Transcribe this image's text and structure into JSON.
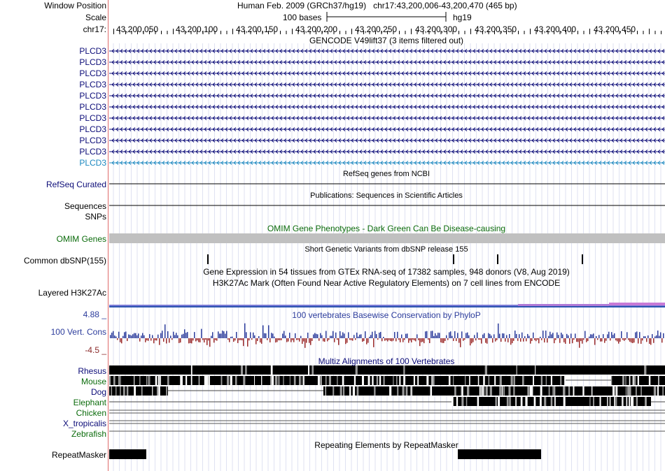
{
  "header": {
    "window_position_label": "Window Position",
    "window_position_value": "Human Feb. 2009 (GRCh37/hg19)   chr17:43,200,006-43,200,470 (465 bp)",
    "scale_label": "Scale",
    "scale_bar_text": "100 bases",
    "assembly": "hg19",
    "chrom_label": "chr17:",
    "ticks": [
      "43,200,050",
      "43,200,100",
      "43,200,150",
      "43,200,200",
      "43,200,250",
      "43,200,300",
      "43,200,350",
      "43,200,400",
      "43,200,450"
    ]
  },
  "gencode": {
    "title": "GENCODE V49lift37 (3 items filtered out)",
    "genes": [
      "PLCD3",
      "PLCD3",
      "PLCD3",
      "PLCD3",
      "PLCD3",
      "PLCD3",
      "PLCD3",
      "PLCD3",
      "PLCD3",
      "PLCD3",
      "PLCD3"
    ]
  },
  "refseq": {
    "title": "RefSeq genes from NCBI",
    "label": "RefSeq Curated"
  },
  "publications": {
    "title": "Publications: Sequences in Scientific Articles",
    "label": "Sequences"
  },
  "snps": {
    "label": "SNPs"
  },
  "omim": {
    "title": "OMIM Gene Phenotypes - Dark Green Can Be Disease-causing",
    "label": "OMIM Genes"
  },
  "dbsnp": {
    "title": "Short Genetic Variants from dbSNP release 155",
    "label": "Common dbSNP(155)"
  },
  "gtex": {
    "title": "Gene Expression in 54 tissues from GTEx RNA-seq of 17382 samples, 948 donors (V8, Aug 2019)"
  },
  "h3k27ac": {
    "title": "H3K27Ac Mark (Often Found Near Active Regulatory Elements) on 7 cell lines from ENCODE",
    "label": "Layered H3K27Ac"
  },
  "phylop": {
    "title": "100 vertebrates Basewise Conservation by PhyloP",
    "label": "100 Vert. Cons",
    "max_label": "4.88 _",
    "min_label": "-4.5 _"
  },
  "multiz": {
    "title": "Multiz Alignments of 100 Vertebrates",
    "species": [
      "Rhesus",
      "Mouse",
      "Dog",
      "Elephant",
      "Chicken",
      "X_tropicalis",
      "Zebrafish"
    ]
  },
  "repeatmasker": {
    "title": "Repeating Elements by RepeatMasker",
    "label": "RepeatMasker"
  },
  "colors": {
    "gene_navy": "#0c0c78",
    "gene_light": "#1c88c0",
    "omim_gray": "#c0c0c0",
    "phylop_pos": "#2c3c9c",
    "phylop_neg": "#9c2c2c",
    "species_green": "#0b6b0b",
    "separator": "#e06b6b"
  }
}
